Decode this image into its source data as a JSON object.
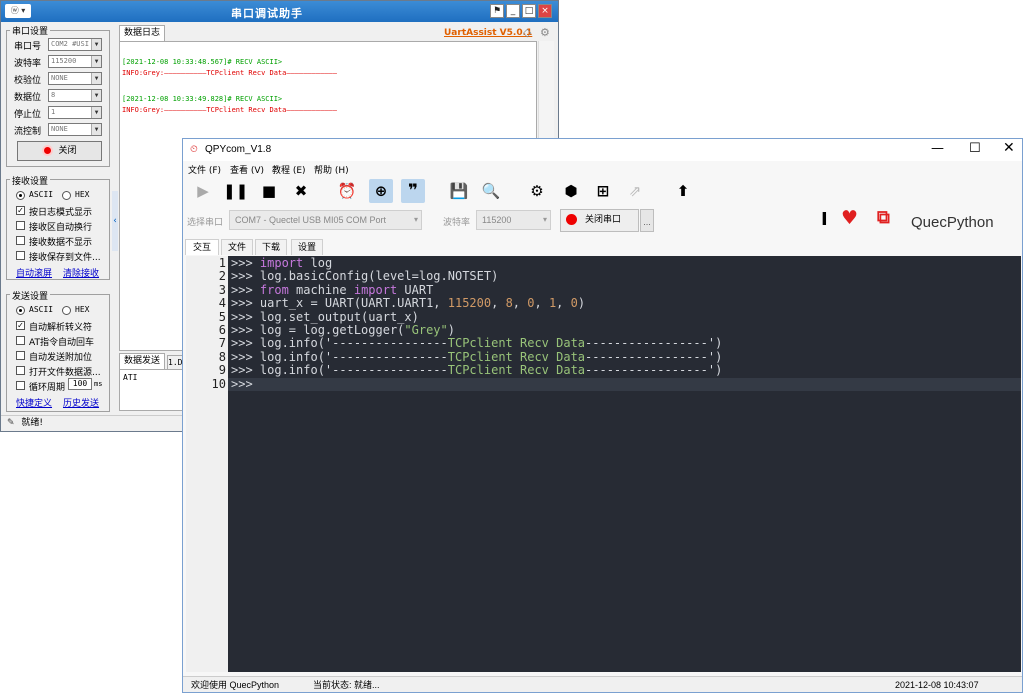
{
  "uart": {
    "title": "串口调试助手",
    "sys_label": "ⓦ ▾",
    "brand": "UartAssist V5.0.1",
    "serial_group": "串口设置",
    "fields": [
      {
        "label": "串口号",
        "value": "COM2 #USI"
      },
      {
        "label": "波特率",
        "value": "115200"
      },
      {
        "label": "校验位",
        "value": "NONE"
      },
      {
        "label": "数据位",
        "value": "8"
      },
      {
        "label": "停止位",
        "value": "1"
      },
      {
        "label": "流控制",
        "value": "NONE"
      }
    ],
    "close_btn": "关闭",
    "recv_group": "接收设置",
    "recv_ascii": "ASCII",
    "recv_hex": "HEX",
    "recv_options": [
      {
        "label": "按日志模式显示",
        "checked": true
      },
      {
        "label": "接收区自动换行",
        "checked": false
      },
      {
        "label": "接收数据不显示",
        "checked": false
      },
      {
        "label": "接收保存到文件...",
        "checked": false
      }
    ],
    "auto_scroll": "自动滚屏",
    "clear_recv": "清除接收",
    "send_group": "发送设置",
    "send_ascii": "ASCII",
    "send_hex": "HEX",
    "send_options": [
      {
        "label": "自动解析转义符",
        "checked": true
      },
      {
        "label": "AT指令自动回车",
        "checked": false
      },
      {
        "label": "自动发送附加位",
        "checked": false
      },
      {
        "label": "打开文件数据源...",
        "checked": false
      },
      {
        "label": "循环周期",
        "checked": false
      }
    ],
    "cycle_value": "100",
    "cycle_unit": "ms",
    "shortcut": "快捷定义",
    "history": "历史发送",
    "log_tab": "数据日志",
    "log": [
      {
        "head": "[2021-12-08 10:33:48.567]# RECV ASCII>",
        "body": "INFO:Grey:——————————TCPclient Recv Data————————————"
      },
      {
        "head": "[2021-12-08 10:33:49.828]# RECV ASCII>",
        "body": "INFO:Grey:——————————TCPclient Recv Data————————————"
      }
    ],
    "send_tab": "数据发送",
    "send_tab2": "1.D",
    "send_text": "ATI",
    "status": "就绪!",
    "colors": {
      "green": "#00a000",
      "red": "#e00000"
    }
  },
  "qpy": {
    "title": "QPYcom_V1.8",
    "menu": [
      "文件 (F)",
      "查看 (V)",
      "教程 (E)",
      "帮助 (H)"
    ],
    "port_label": "选择串口",
    "port_value": "COM7 - Quectel USB MI05 COM Port",
    "baud_label": "波特率",
    "baud_value": "115200",
    "close_port": "关闭串口",
    "more": "...",
    "brand": "QuecPython",
    "tabs": [
      "交互",
      "文件",
      "下载",
      "设置"
    ],
    "status_left": "欢迎使用 QuecPython",
    "status_mid": "当前状态: 就绪...",
    "status_time": "2021-12-08 10:43:07",
    "code_lines": [
      [
        [
          ">>> ",
          ""
        ],
        [
          "import",
          "kw"
        ],
        [
          " log",
          ""
        ]
      ],
      [
        [
          ">>> log.basicConfig(level=log.NOTSET)",
          ""
        ]
      ],
      [
        [
          ">>> ",
          ""
        ],
        [
          "from",
          "kw"
        ],
        [
          " machine ",
          ""
        ],
        [
          "import",
          "kw"
        ],
        [
          " UART",
          ""
        ]
      ],
      [
        [
          ">>> uart_x = UART(UART.UART1, ",
          ""
        ],
        [
          "115200",
          "num"
        ],
        [
          ", ",
          ""
        ],
        [
          "8",
          "num"
        ],
        [
          ", ",
          ""
        ],
        [
          "0",
          "num"
        ],
        [
          ", ",
          ""
        ],
        [
          "1",
          "num"
        ],
        [
          ", ",
          ""
        ],
        [
          "0",
          "num"
        ],
        [
          ")",
          ""
        ]
      ],
      [
        [
          ">>> log.set_output(uart_x)",
          ""
        ]
      ],
      [
        [
          ">>> log = log.getLogger(",
          ""
        ],
        [
          "\"Grey\"",
          "str"
        ],
        [
          ")",
          ""
        ]
      ],
      [
        [
          ">>> log.info('----------------",
          ""
        ],
        [
          "TCPclient Recv Data",
          "str"
        ],
        [
          "-----------------')",
          ""
        ]
      ],
      [
        [
          ">>> log.info('----------------",
          ""
        ],
        [
          "TCPclient Recv Data",
          "str"
        ],
        [
          "-----------------')",
          ""
        ]
      ],
      [
        [
          ">>> log.info('----------------",
          ""
        ],
        [
          "TCPclient Recv Data",
          "str"
        ],
        [
          "-----------------')",
          ""
        ]
      ],
      [
        [
          ">>> ",
          ""
        ]
      ]
    ]
  }
}
